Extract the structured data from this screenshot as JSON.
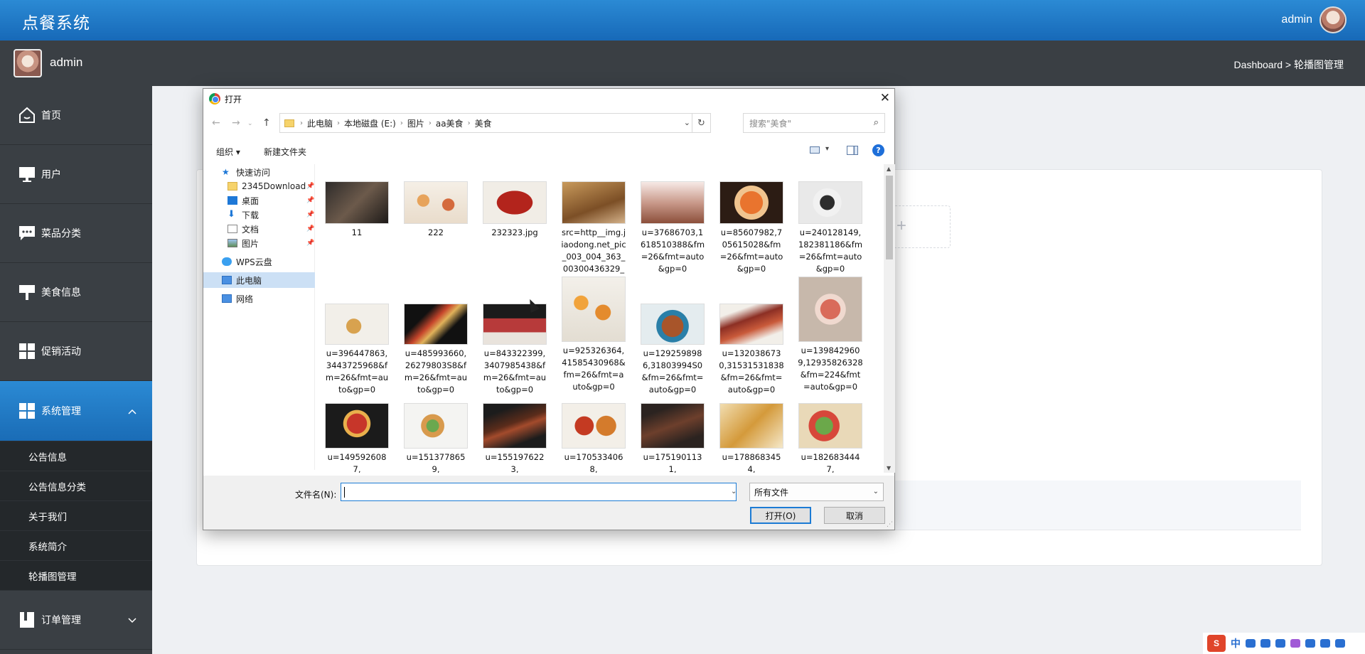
{
  "app": {
    "title": "点餐系统",
    "user": "admin"
  },
  "subbar": {
    "name": "admin",
    "breadcrumb": "Dashboard > 轮播图管理"
  },
  "sidebar": {
    "items": [
      {
        "label": "首页",
        "icon": "home-icon"
      },
      {
        "label": "用户",
        "icon": "monitor-icon"
      },
      {
        "label": "菜品分类",
        "icon": "chat-icon"
      },
      {
        "label": "美食信息",
        "icon": "sign-icon"
      },
      {
        "label": "促销活动",
        "icon": "grid-icon"
      },
      {
        "label": "系统管理",
        "icon": "grid-icon",
        "active": true,
        "chevron": "^"
      }
    ],
    "sub_items": [
      "公告信息",
      "公告信息分类",
      "关于我们",
      "系统简介",
      "轮播图管理"
    ],
    "order": {
      "label": "订单管理",
      "chevron": "⌄"
    }
  },
  "dialog": {
    "title": "打开",
    "address": [
      "此电脑",
      "本地磁盘 (E:)",
      "图片",
      "aa美食",
      "美食"
    ],
    "search_placeholder": "搜索\"美食\"",
    "toolbar": {
      "organize": "组织 ▾",
      "new_folder": "新建文件夹",
      "help": "?"
    },
    "tree": [
      {
        "label": "快速访问",
        "icon": "star-icon"
      },
      {
        "label": "2345Download",
        "icon": "folder-icon",
        "pinned": true
      },
      {
        "label": "桌面",
        "icon": "desktop-icon",
        "pinned": true
      },
      {
        "label": "下载",
        "icon": "download-icon",
        "pinned": true
      },
      {
        "label": "文档",
        "icon": "document-icon",
        "pinned": true
      },
      {
        "label": "图片",
        "icon": "picture-icon",
        "pinned": true
      },
      {
        "label": "WPS云盘",
        "icon": "cloud-icon"
      },
      {
        "label": "此电脑",
        "icon": "computer-icon",
        "selected": true
      },
      {
        "label": "网络",
        "icon": "network-icon"
      }
    ],
    "files": [
      "11",
      "222",
      "232323.jpg",
      "src=http__img.jiaodong.net_pic_003_004_363_00300436329_e...",
      "u=37686703,1618510388&fm=26&fmt=auto&gp=0",
      "u=85607982,705615028&fm=26&fmt=auto&gp=0",
      "u=240128149,182381186&fm=26&fmt=auto&gp=0",
      "u=396447863,3443725968&fm=26&fmt=auto&gp=0",
      "u=485993660,26279803S8&fm=26&fmt=auto&gp=0",
      "u=843322399,3407985438&fm=26&fmt=auto&gp=0",
      "u=925326364,41585430968&fm=26&fmt=auto&gp=0",
      "u=1292598986,31803994S0&fm=26&fmt=auto&gp=0",
      "u=1320386730,31531531838&fm=26&fmt=auto&gp=0",
      "u=1398429609,12935826328&fm=224&fmt=auto&gp=0",
      "u=1495926087,",
      "u=1513778659,",
      "u=1551976223,",
      "u=1705334068,",
      "u=1751901131,",
      "u=1788683454,",
      "u=1826834447,"
    ],
    "filename_label": "文件名(N):",
    "filename_value": "",
    "filetype": "所有文件",
    "open_label": "打开(O)",
    "cancel_label": "取消"
  },
  "tray": {
    "brand": "S",
    "ime": "中"
  },
  "colors": {
    "primary": "#1769b8",
    "sidebar": "#3a3f44",
    "submenu": "#24282b"
  }
}
